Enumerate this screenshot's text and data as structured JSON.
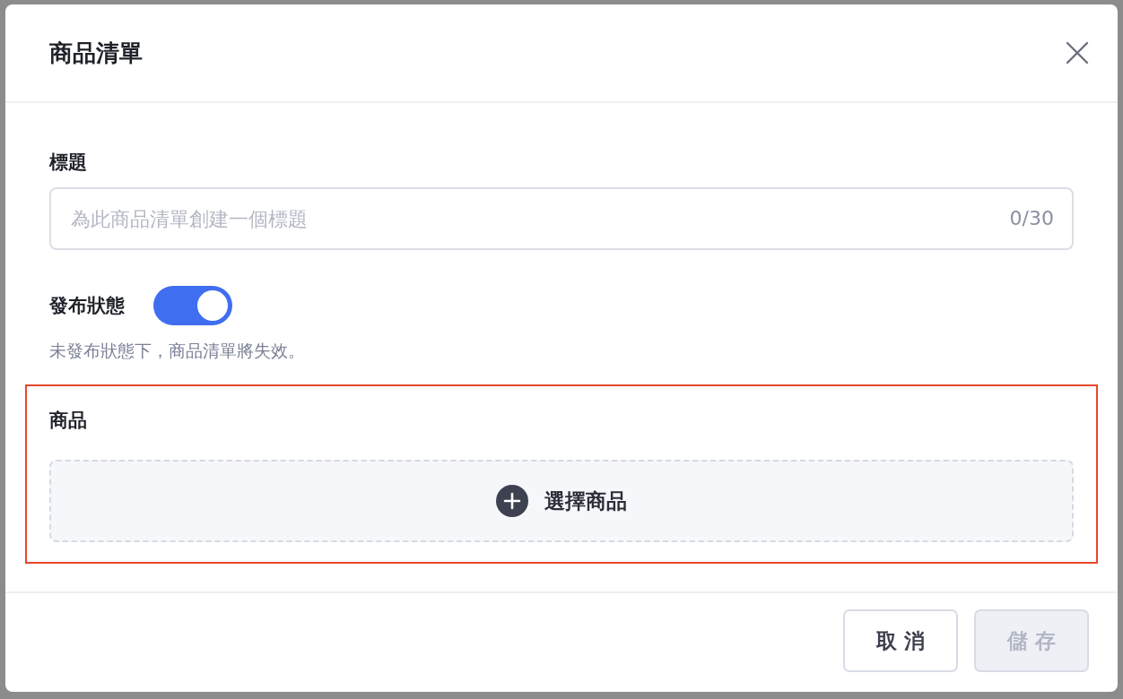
{
  "dialog": {
    "title": "商品清單"
  },
  "title_field": {
    "label": "標題",
    "placeholder": "為此商品清單創建一個標題",
    "counter": "0/30"
  },
  "publish": {
    "label": "發布狀態",
    "on": true,
    "hint": "未發布狀態下，商品清單將失效。"
  },
  "products": {
    "label": "商品",
    "highlighted": true,
    "add_button": "選擇商品"
  },
  "buttons": [
    {
      "label": "取 消",
      "disabled": false
    },
    {
      "label": "儲 存",
      "disabled": true
    }
  ]
}
